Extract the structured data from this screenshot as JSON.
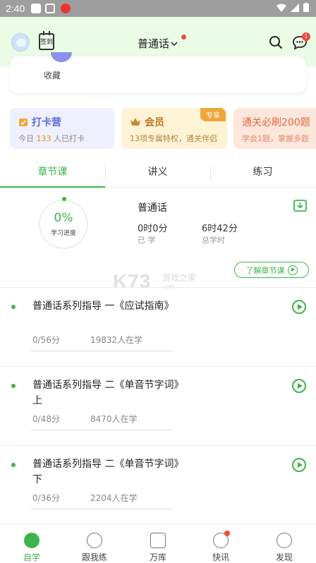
{
  "status_bar": {
    "time": "2:40"
  },
  "header": {
    "checkin_label": "签到",
    "subject": "普通话",
    "message_badge": "1"
  },
  "favorites": {
    "label": "收藏"
  },
  "promos": [
    {
      "title": "打卡营",
      "desc_prefix": "今日 ",
      "desc_count": "133",
      "desc_suffix": " 人已打卡"
    },
    {
      "title": "会员",
      "tag": "专享",
      "desc": "13项专属特权，通关伴侣"
    },
    {
      "title": "通关必刷200题",
      "desc": "学会1题，掌握多题"
    }
  ],
  "tabs": [
    {
      "label": "章节课",
      "active": true
    },
    {
      "label": "讲义",
      "active": false
    },
    {
      "label": "练习",
      "active": false
    }
  ],
  "progress": {
    "percent": "0%",
    "label": "学习进度"
  },
  "course": {
    "name": "普通话",
    "studied_value": "0时0分",
    "studied_label": "已 学",
    "total_value": "6时42分",
    "total_label": "总学时",
    "learn_button": "了解章节课"
  },
  "lessons": [
    {
      "title": "普通话系列指导 一《应试指南》",
      "score": "0/56分",
      "learners": "19832人在学"
    },
    {
      "title": "普通话系列指导 二《单音节字词》上",
      "score": "0/48分",
      "learners": "8470人在学"
    },
    {
      "title": "普通话系列指导 二《单音节字词》下",
      "score": "0/36分",
      "learners": "2204人在学"
    }
  ],
  "watermark": {
    "logo": "K73",
    "name": "游戏之家",
    "url": ".com"
  },
  "bottom_nav": [
    {
      "label": "自学",
      "active": true
    },
    {
      "label": "跟我练",
      "active": false
    },
    {
      "label": "万库",
      "active": false
    },
    {
      "label": "快讯",
      "active": false,
      "dot": true
    },
    {
      "label": "发现",
      "active": false
    }
  ],
  "colors": {
    "accent": "#3bb54a",
    "header_bg": "#eafbe6",
    "badge": "#f04a3a"
  }
}
